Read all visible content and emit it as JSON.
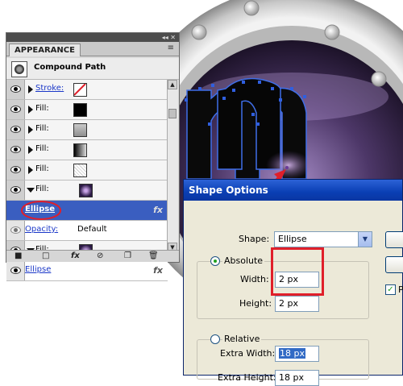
{
  "appearance_panel": {
    "tab_label": "APPEARANCE",
    "title": "Compound Path",
    "rows": [
      {
        "label": "Stroke:",
        "kind": "stroke"
      },
      {
        "label": "Fill:",
        "kind": "black"
      },
      {
        "label": "Fill:",
        "kind": "grey"
      },
      {
        "label": "Fill:",
        "kind": "gradient"
      },
      {
        "label": "Fill:",
        "kind": "dots"
      },
      {
        "label": "Fill:",
        "kind": "purple"
      }
    ],
    "selected_effect": "Ellipse",
    "opacity_label": "Opacity:",
    "opacity_value": "Default",
    "fill2_label": "Fill:",
    "ellipse2_label": "Ellipse",
    "fx_label": "fx",
    "panel_controls": "◂◂ ✕",
    "menu_icon": "≡",
    "footer_fx": "fx"
  },
  "dialog": {
    "title": "Shape Options",
    "shape_label": "Shape:",
    "shape_value": "Ellipse",
    "absolute_label": "Absolute",
    "width_label": "Width:",
    "width_value": "2 px",
    "height_label": "Height:",
    "height_value": "2 px",
    "relative_label": "Relative",
    "extra_width_label": "Extra Width:",
    "extra_width_value": "18 px",
    "extra_height_label": "Extra Height:",
    "extra_height_value": "18 px",
    "preview_label": "P"
  },
  "colors": {
    "annotation_red": "#e01f2a",
    "dialog_title_blue": "#0a3fb4",
    "selection_blue": "#3a5ec0"
  }
}
